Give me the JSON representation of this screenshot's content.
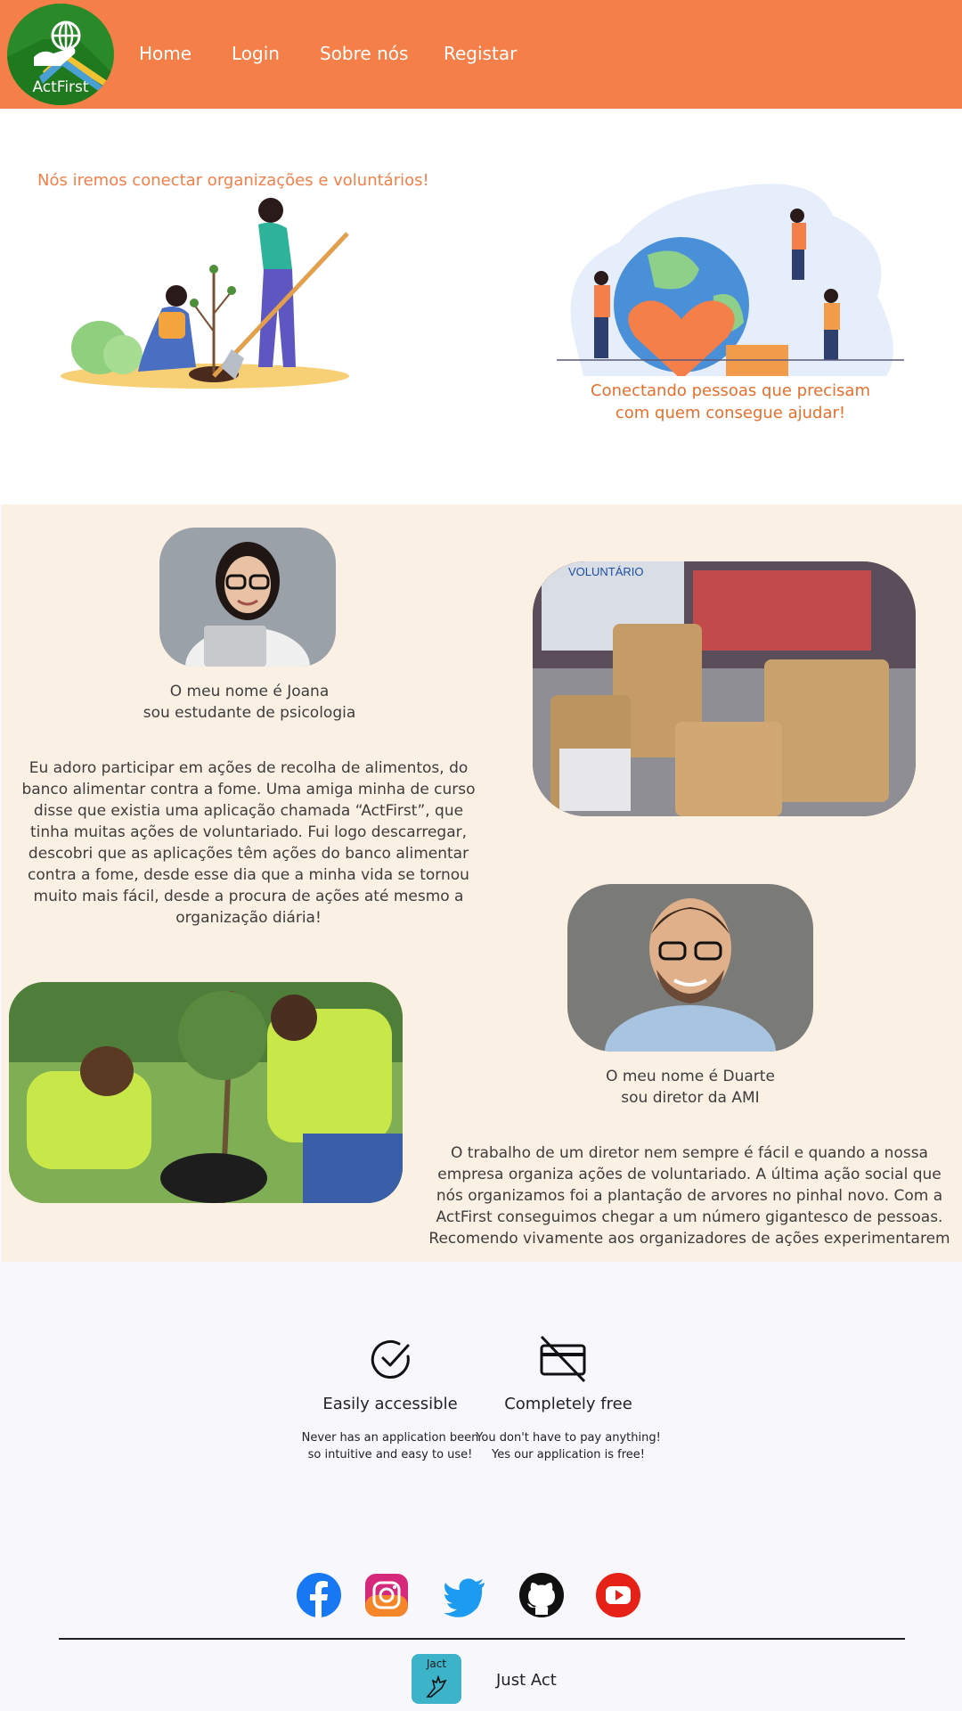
{
  "header": {
    "logo_text": "ActFirst",
    "nav": [
      "Home",
      "Login",
      "Sobre nós",
      "Registar"
    ],
    "bg_color": "#f57f48"
  },
  "hero": {
    "left_tagline": "Nós iremos conectar organizações e voluntários!",
    "right_caption_line1": "Conectando pessoas que precisam",
    "right_caption_line2": "com quem consegue ajudar!"
  },
  "testimonials": {
    "joana": {
      "name_line": "O meu nome é Joana",
      "role_line": "sou estudante de psicologia",
      "text": "Eu adoro participar em ações de recolha de alimentos, do banco alimentar contra a fome. Uma amiga minha de curso disse que existia uma aplicação chamada “ActFirst”, que tinha muitas ações de voluntariado. Fui logo descarregar, descobri que as aplicações têm ações do banco alimentar contra a fome, desde esse dia que a minha vida se tornou muito mais fácil, desde a procura de ações até mesmo a organização diária!"
    },
    "duarte": {
      "name_line": "O meu nome é Duarte",
      "role_line": "sou diretor da AMI",
      "text": "O trabalho de um diretor nem sempre é fácil e quando a nossa empresa organiza ações de voluntariado. A última ação social que nós organizamos foi a plantação de arvores no pinhal novo. Com a ActFirst conseguimos chegar a um número gigantesco de pessoas. Recomendo vivamente aos organizadores de ações experimentarem"
    },
    "bg_color": "#fbf0e4"
  },
  "features": [
    {
      "icon": "check-circle-icon",
      "title": "Easily accessible",
      "desc_line1": "Never has an application been",
      "desc_line2": "so intuitive and easy to use!"
    },
    {
      "icon": "no-credit-card-icon",
      "title": "Completely free",
      "desc_line1": "You don't have to pay anything!",
      "desc_line2": "Yes our application is free!"
    }
  ],
  "footer": {
    "social": [
      "facebook-icon",
      "instagram-icon",
      "twitter-icon",
      "github-icon",
      "youtube-icon"
    ],
    "badge_text": "Jact",
    "brand": "Just Act"
  }
}
